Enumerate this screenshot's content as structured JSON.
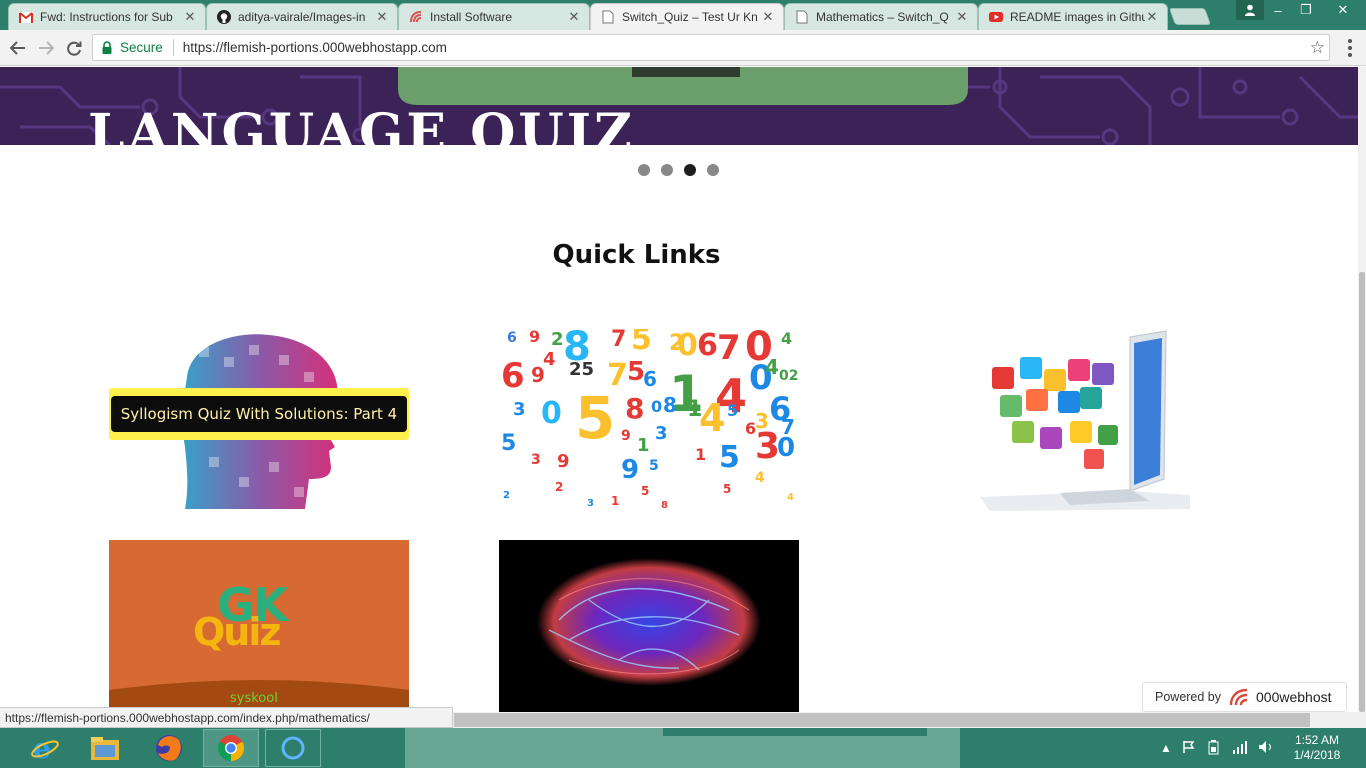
{
  "browser": {
    "tabs": [
      {
        "label": "Fwd: Instructions for Sub",
        "icon": "gmail-icon",
        "active": false
      },
      {
        "label": "aditya-vairale/Images-in",
        "icon": "github-icon",
        "active": false
      },
      {
        "label": "Install Software",
        "icon": "web-icon",
        "active": false
      },
      {
        "label": "Switch_Quiz – Test Ur Kn",
        "icon": "page-icon",
        "active": true
      },
      {
        "label": "Mathematics – Switch_Q",
        "icon": "page-icon",
        "active": false
      },
      {
        "label": "README images in Githu",
        "icon": "youtube-icon",
        "active": false
      }
    ],
    "tab_close": "✕",
    "window_controls": {
      "minimize": "–",
      "maximize": "❐",
      "close": "✕"
    },
    "secure_label": "Secure",
    "url": "https://flemish-portions.000webhostapp.com",
    "status_url": "https://flemish-portions.000webhostapp.com/index.php/mathematics/"
  },
  "page": {
    "banner_title": "LANGUAGE QUIZ",
    "slider": {
      "count": 4,
      "active_index": 2
    },
    "section_title": "Quick Links",
    "cards": [
      {
        "name": "syllogism-quiz",
        "label": "Syllogism Quiz With Solutions: Part 4"
      },
      {
        "name": "mathematics-numbers"
      },
      {
        "name": "computer-laptop"
      },
      {
        "name": "gk-quiz",
        "logo_gk": "GK",
        "logo_quiz": "Quiz",
        "footer": "syskool"
      },
      {
        "name": "brain-scan"
      }
    ],
    "powered_by": "Powered by",
    "powered_brand": "000webhost"
  },
  "taskbar": {
    "apps": [
      "internet-explorer-icon",
      "file-explorer-icon",
      "firefox-icon",
      "chrome-icon",
      "cortana-icon"
    ],
    "active_app": "chrome-icon",
    "time": "1:52 AM",
    "date": "1/4/2018"
  },
  "colors": {
    "tabstrip": "#2d7e6b",
    "banner": "#3b2257",
    "secure_green": "#0b8043",
    "gk_background": "#d66a32"
  }
}
